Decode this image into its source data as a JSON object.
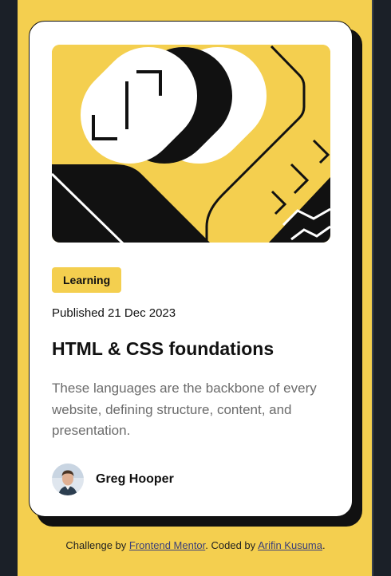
{
  "card": {
    "tag": "Learning",
    "published": "Published 21 Dec 2023",
    "title": "HTML & CSS foundations",
    "description": "These languages are the backbone of every website, defining structure, content, and presentation.",
    "author": "Greg Hooper"
  },
  "footer": {
    "prefix": "Challenge by ",
    "mentor_link": "Frontend Mentor",
    "middle": ". Coded by ",
    "author_link": "Arifin Kusuma",
    "suffix": "."
  },
  "colors": {
    "accent": "#f4cf4f",
    "ink": "#111111",
    "muted": "#6b6b6b",
    "frame": "#1b2028"
  },
  "icons": [
    "brackets-illustration",
    "avatar-photo"
  ]
}
